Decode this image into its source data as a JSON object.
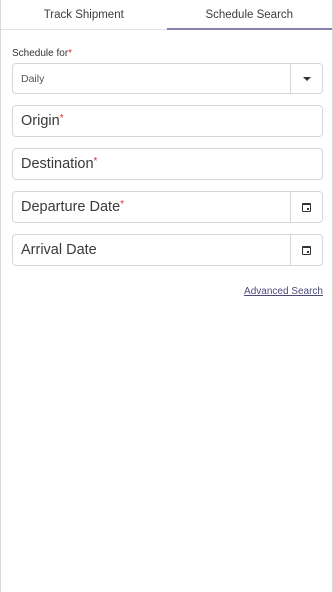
{
  "tabs": [
    {
      "label": "Track Shipment"
    },
    {
      "label": "Schedule Search"
    }
  ],
  "form": {
    "schedule_label": "Schedule for",
    "required_mark": "*",
    "schedule_value": "Daily",
    "origin_label": "Origin",
    "destination_label": "Destination",
    "departure_label": "Departure Date",
    "arrival_label": "Arrival Date",
    "advanced_link": "Advanced Search"
  },
  "active_tab": "Schedule Search",
  "colors": {
    "accent": "#8a7fae",
    "required": "#e02f2f",
    "link": "#4d4a7a"
  }
}
